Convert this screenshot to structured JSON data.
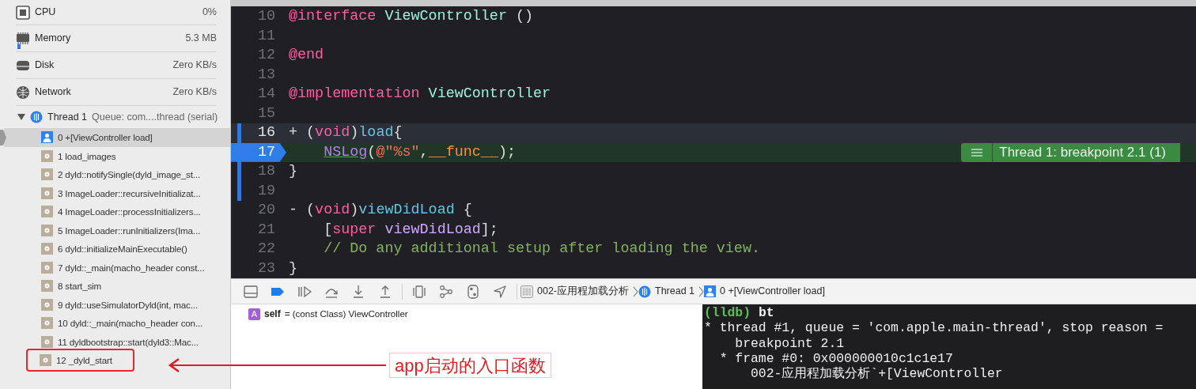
{
  "gauges": [
    {
      "kind": "cpu",
      "label": "CPU",
      "value": "0%"
    },
    {
      "kind": "memory",
      "label": "Memory",
      "value": "5.3 MB",
      "level": 0.02
    },
    {
      "kind": "disk",
      "label": "Disk",
      "value": "Zero KB/s"
    },
    {
      "kind": "network",
      "label": "Network",
      "value": "Zero KB/s"
    }
  ],
  "thread": {
    "label": "Thread 1",
    "detail": "Queue: com....thread (serial)",
    "expanded": true,
    "frames": [
      {
        "kind": "user",
        "label": "0 +[ViewController load]",
        "selected": true,
        "callout": false
      },
      {
        "kind": "system",
        "label": "1 load_images",
        "selected": false,
        "callout": false
      },
      {
        "kind": "system",
        "label": "2 dyld::notifySingle(dyld_image_st...",
        "selected": false,
        "callout": false
      },
      {
        "kind": "system",
        "label": "3 ImageLoader::recursiveInitializat...",
        "selected": false,
        "callout": false
      },
      {
        "kind": "system",
        "label": "4 ImageLoader::processInitializers...",
        "selected": false,
        "callout": false
      },
      {
        "kind": "system",
        "label": "5 ImageLoader::runInitializers(Ima...",
        "selected": false,
        "callout": false
      },
      {
        "kind": "system",
        "label": "6 dyld::initializeMainExecutable()",
        "selected": false,
        "callout": false
      },
      {
        "kind": "system",
        "label": "7 dyld::_main(macho_header const...",
        "selected": false,
        "callout": false
      },
      {
        "kind": "system",
        "label": "8 start_sim",
        "selected": false,
        "callout": false
      },
      {
        "kind": "system",
        "label": "9 dyld::useSimulatorDyld(int, mac...",
        "selected": false,
        "callout": false
      },
      {
        "kind": "system",
        "label": "10 dyld::_main(macho_header con...",
        "selected": false,
        "callout": false
      },
      {
        "kind": "system",
        "label": "11 dyldbootstrap::start(dyld3::Mac...",
        "selected": false,
        "callout": false
      },
      {
        "kind": "system",
        "label": "12 _dyld_start",
        "selected": false,
        "callout": true
      }
    ]
  },
  "callout": {
    "text": "app启动的入口函数"
  },
  "editor": {
    "lines": [
      {
        "number": "10",
        "current": false,
        "stopped": false,
        "changed": false,
        "tokens": [
          {
            "kind": "keyword",
            "text": "@interface "
          },
          {
            "kind": "class",
            "text": "ViewController"
          },
          {
            "kind": "plain",
            "text": " ()"
          }
        ]
      },
      {
        "number": "11",
        "current": false,
        "stopped": false,
        "changed": false
      },
      {
        "number": "12",
        "current": false,
        "stopped": false,
        "changed": false,
        "tokens": [
          {
            "kind": "keyword",
            "text": "@end"
          }
        ]
      },
      {
        "number": "13",
        "current": false,
        "stopped": false,
        "changed": false
      },
      {
        "number": "14",
        "current": false,
        "stopped": false,
        "changed": false,
        "tokens": [
          {
            "kind": "keyword",
            "text": "@implementation "
          },
          {
            "kind": "class",
            "text": "ViewController"
          }
        ]
      },
      {
        "number": "15",
        "current": false,
        "stopped": false,
        "changed": false
      },
      {
        "number": "16",
        "current": true,
        "stopped": false,
        "changed": true,
        "tokens": [
          {
            "kind": "plain",
            "text": "+ ("
          },
          {
            "kind": "keyword",
            "text": "void"
          },
          {
            "kind": "plain",
            "text": ")"
          },
          {
            "kind": "decl",
            "text": "load"
          },
          {
            "kind": "plain",
            "text": "{"
          }
        ]
      },
      {
        "number": "17",
        "current": false,
        "stopped": true,
        "changed": true,
        "annotation": "Thread 1: breakpoint 2.1 (1)",
        "tokens": [
          {
            "kind": "func",
            "text": "    NSLog"
          },
          {
            "kind": "plain",
            "text": "("
          },
          {
            "kind": "string",
            "text": "@\"%s\""
          },
          {
            "kind": "plain",
            "text": ","
          },
          {
            "kind": "macro",
            "text": "__func__"
          },
          {
            "kind": "plain",
            "text": ");"
          }
        ]
      },
      {
        "number": "18",
        "current": false,
        "stopped": false,
        "changed": true,
        "tokens": [
          {
            "kind": "plain",
            "text": "}"
          }
        ]
      },
      {
        "number": "19",
        "current": false,
        "stopped": false,
        "changed": true
      },
      {
        "number": "20",
        "current": false,
        "stopped": false,
        "changed": false,
        "tokens": [
          {
            "kind": "plain",
            "text": "- ("
          },
          {
            "kind": "keyword",
            "text": "void"
          },
          {
            "kind": "plain",
            "text": ")"
          },
          {
            "kind": "decl",
            "text": "viewDidLoad"
          },
          {
            "kind": "plain",
            "text": " {"
          }
        ]
      },
      {
        "number": "21",
        "current": false,
        "stopped": false,
        "changed": false,
        "tokens": [
          {
            "kind": "plain",
            "text": "    ["
          },
          {
            "kind": "keyword",
            "text": "super "
          },
          {
            "kind": "method",
            "text": "viewDidLoad"
          },
          {
            "kind": "plain",
            "text": "];"
          }
        ]
      },
      {
        "number": "22",
        "current": false,
        "stopped": false,
        "changed": false,
        "tokens": [
          {
            "kind": "comment",
            "text": "    // Do any additional setup after loading the view."
          }
        ]
      },
      {
        "number": "23",
        "current": false,
        "stopped": false,
        "changed": false,
        "tokens": [
          {
            "kind": "plain",
            "text": "}"
          }
        ]
      }
    ]
  },
  "debug_bar": {
    "buttons": [
      {
        "kind": "console",
        "on": false
      },
      {
        "kind": "breakpoints",
        "on": true
      },
      {
        "kind": "continue",
        "on": false
      },
      {
        "kind": "step-over",
        "on": false
      },
      {
        "kind": "step-into",
        "on": false
      },
      {
        "kind": "step-out",
        "on": false
      },
      {
        "kind": "view-debugger",
        "on": false
      },
      {
        "kind": "memory-graph",
        "on": false
      },
      {
        "kind": "environment",
        "on": false
      },
      {
        "kind": "location",
        "on": false
      }
    ],
    "breadcrumbs": [
      {
        "kind": "project",
        "text": "002-应用程加载分析"
      },
      {
        "kind": "thread",
        "text": "Thread 1"
      },
      {
        "kind": "frame",
        "text": "0 +[ViewController load]"
      }
    ]
  },
  "variables": [
    {
      "badge": "A",
      "name": "self",
      "value": "= (const Class) ViewController"
    }
  ],
  "console": {
    "lines": [
      {
        "kind": "prompt",
        "prompt": "(lldb)",
        "text": "bt"
      },
      {
        "kind": "output",
        "text": "* thread #1, queue = 'com.apple.main-thread', stop reason ="
      },
      {
        "kind": "output",
        "text": "    breakpoint 2.1"
      },
      {
        "kind": "output",
        "text": "  * frame #0: 0x000000010c1c1e17"
      },
      {
        "kind": "output",
        "text": "      002-应用程加载分析`+[ViewController"
      }
    ]
  }
}
